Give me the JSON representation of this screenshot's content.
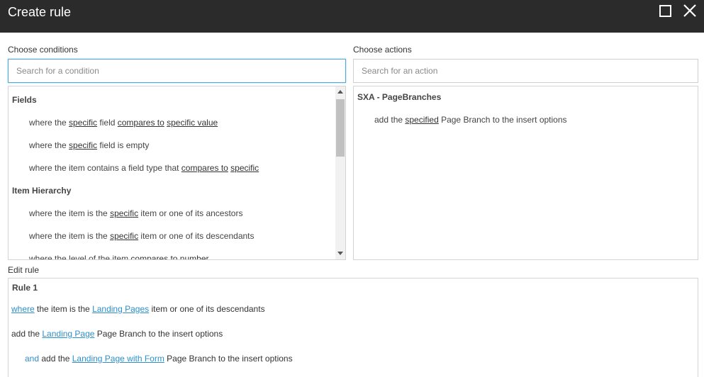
{
  "dialog": {
    "title": "Create rule",
    "maximize_icon": "maximize-icon",
    "close_icon": "close-icon"
  },
  "conditions": {
    "label": "Choose conditions",
    "search_placeholder": "Search for a condition",
    "groups": [
      {
        "name": "Fields",
        "items": [
          {
            "parts": [
              "where the ",
              "specific",
              " field ",
              "compares to",
              " ",
              "specific value"
            ]
          },
          {
            "parts": [
              "where the ",
              "specific",
              " field is empty"
            ]
          },
          {
            "parts": [
              "where the item contains a field type that ",
              "compares to",
              " ",
              "specific"
            ]
          }
        ]
      },
      {
        "name": "Item Hierarchy",
        "items": [
          {
            "parts": [
              "where the item is the ",
              "specific",
              " item or one of its ancestors"
            ]
          },
          {
            "parts": [
              "where the item is the ",
              "specific",
              " item or one of its descendants"
            ]
          },
          {
            "parts": [
              "where the level of the item ",
              "compares to",
              " ",
              "number"
            ]
          }
        ]
      }
    ]
  },
  "actions": {
    "label": "Choose actions",
    "search_placeholder": "Search for an action",
    "groups": [
      {
        "name": "SXA - PageBranches",
        "items": [
          {
            "parts": [
              "add the ",
              "specified",
              " Page Branch to the insert options"
            ]
          }
        ]
      }
    ]
  },
  "edit_rule": {
    "label": "Edit rule",
    "rule_name": "Rule 1",
    "lines": [
      {
        "parts": [
          "where",
          " the item is the ",
          "Landing Pages",
          " item or one of its descendants"
        ]
      },
      {
        "parts": [
          "add the ",
          "Landing Page",
          " Page Branch to the insert options"
        ]
      },
      {
        "parts": [
          "and",
          " add the ",
          "Landing Page with Form",
          " Page Branch to the insert options"
        ]
      }
    ]
  },
  "colors": {
    "titlebar": "#2b2b2b",
    "link": "#2e8fc9",
    "focus_border": "#52a7d4"
  }
}
